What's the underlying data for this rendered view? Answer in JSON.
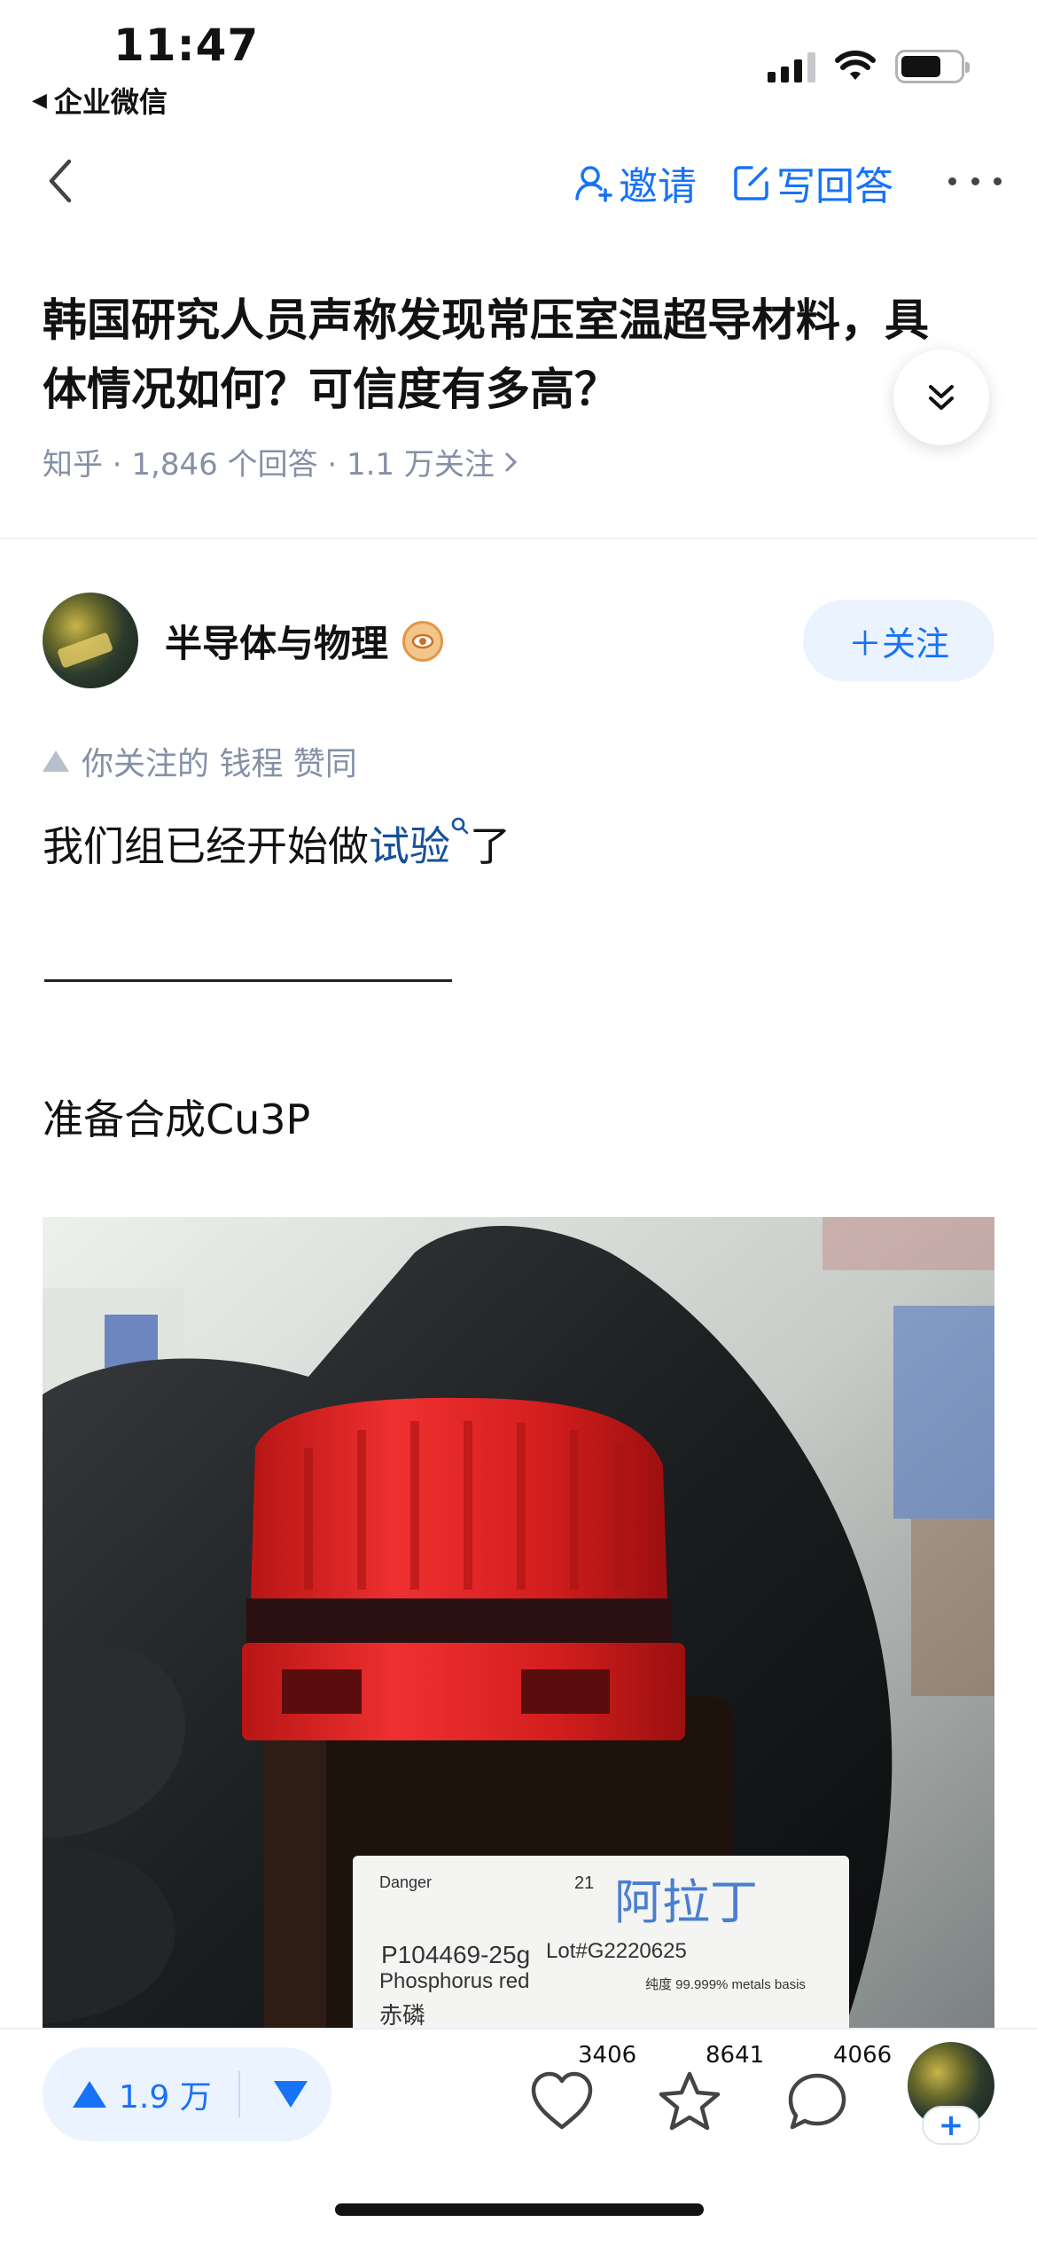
{
  "status_bar": {
    "time": "11:47",
    "back_app": "企业微信"
  },
  "nav": {
    "invite_label": "邀请",
    "write_answer_label": "写回答"
  },
  "question": {
    "title": "韩国研究人员声称发现常压室温超导材料，具体情况如何？可信度有多高？",
    "meta": "知乎 · 1,846 个回答 · 1.1 万关注"
  },
  "author": {
    "name": "半导体与物理",
    "follow_label": "＋关注"
  },
  "endorsement": "你关注的 钱程 赞同",
  "answer": {
    "p1_before": "我们组已经开始做",
    "p1_link": "试验",
    "p1_after": "了",
    "separator": "————————————-",
    "p2": "准备合成Cu3P"
  },
  "photo": {
    "label_danger": "Danger",
    "label_num": "21",
    "label_brand": "阿拉丁",
    "label_code": "P104469-25g",
    "label_lot": "Lot#G2220625",
    "label_name_en": "Phosphorus red",
    "label_name_cn": "赤磷",
    "label_purity": "纯度 99.999% metals basis",
    "description": ""
  },
  "bottom_bar": {
    "vote_count": "1.9 万",
    "like_count": "3406",
    "favorite_count": "8641",
    "comment_count": "4066"
  },
  "colors": {
    "accent": "#1772f6",
    "link": "#175199",
    "meta_gray": "#8590a6"
  }
}
